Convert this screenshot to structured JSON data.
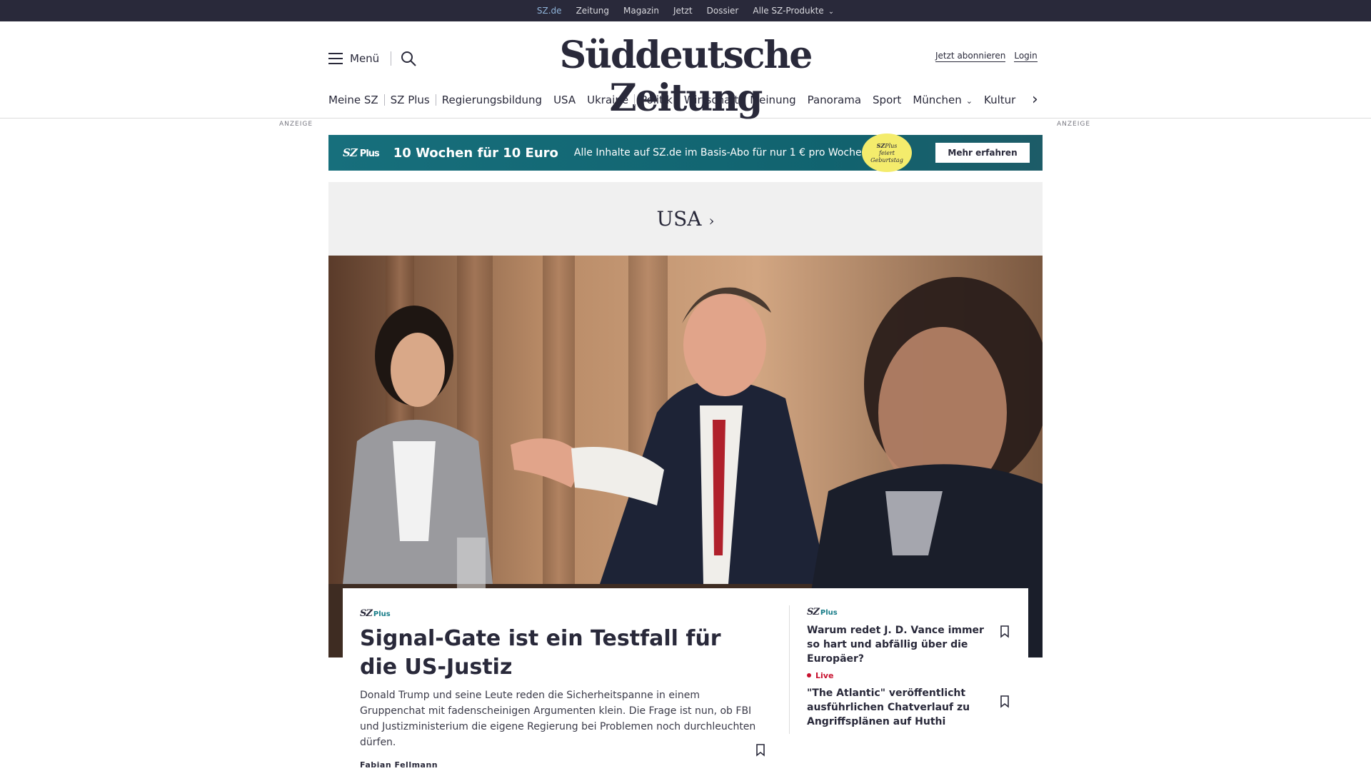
{
  "topbar": {
    "links": [
      "SZ.de",
      "Zeitung",
      "Magazin",
      "Jetzt",
      "Dossier",
      "Alle SZ-Produkte"
    ]
  },
  "header": {
    "menu_label": "Menü",
    "logo_text": "Süddeutsche Zeitung",
    "subscribe_label": "Jetzt abonnieren",
    "login_label": "Login"
  },
  "nav": {
    "items": [
      "Meine SZ",
      "SZ Plus",
      "Regierungsbildung",
      "USA",
      "Ukraine",
      "Politik",
      "Wirtschaft",
      "Meinung",
      "Panorama",
      "Sport",
      "München",
      "Kultur"
    ]
  },
  "ad": {
    "label": "ANZEIGE",
    "brand": "SZ",
    "brand_plus": "Plus",
    "headline": "10 Wochen für 10 Euro",
    "subline": "Alle Inhalte auf SZ.de im Basis-Abo für nur 1 € pro Woche.",
    "badge_brand": "SZ",
    "badge_plus": "Plus",
    "badge_line1": "feiert",
    "badge_line2": "Geburtstag",
    "cta": "Mehr erfahren"
  },
  "section": {
    "title": "USA"
  },
  "main_article": {
    "tag_brand": "SZ",
    "tag_plus": "Plus",
    "title": "Signal-Gate ist ein Testfall für die US-Justiz",
    "teaser": "Donald Trump und seine Leute reden die Sicherheitspanne in einem Gruppenchat mit fadenscheinigen Argumenten klein. Die Frage ist nun, ob FBI und Justizministerium die eigene Regierung bei Problemen noch durchleuchten dürfen.",
    "author": "Fabian Fellmann"
  },
  "side_articles": [
    {
      "tag_brand": "SZ",
      "tag_plus": "Plus",
      "title": "Warum redet J. D. Vance immer so hart und abfällig über die Europäer?"
    },
    {
      "live_label": "Live",
      "title": "\"The Atlantic\" veröffentlicht ausführlichen Chatverlauf zu Angriffsplänen auf Huthi"
    }
  ],
  "colors": {
    "ink": "#29293a",
    "accent_teal": "#177c88",
    "live_red": "#c8102e",
    "badge_yellow": "#f4ec6c"
  }
}
